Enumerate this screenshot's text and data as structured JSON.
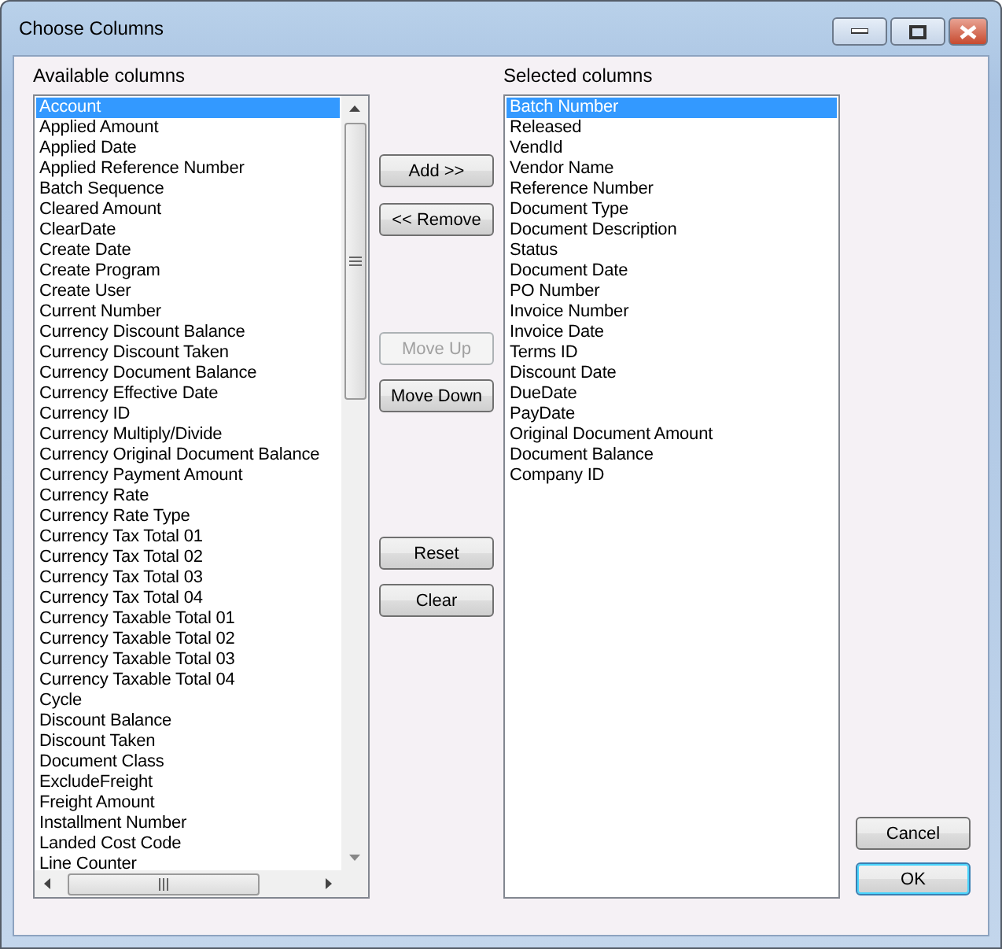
{
  "window": {
    "title": "Choose Columns"
  },
  "available": {
    "label": "Available columns",
    "items": [
      {
        "label": "Account",
        "selected": true
      },
      {
        "label": "Applied Amount",
        "selected": false
      },
      {
        "label": "Applied Date",
        "selected": false
      },
      {
        "label": "Applied Reference Number",
        "selected": false
      },
      {
        "label": "Batch Sequence",
        "selected": false
      },
      {
        "label": "Cleared Amount",
        "selected": false
      },
      {
        "label": "ClearDate",
        "selected": false
      },
      {
        "label": "Create Date",
        "selected": false
      },
      {
        "label": "Create Program",
        "selected": false
      },
      {
        "label": "Create User",
        "selected": false
      },
      {
        "label": "Current Number",
        "selected": false
      },
      {
        "label": "Currency Discount Balance",
        "selected": false
      },
      {
        "label": "Currency Discount Taken",
        "selected": false
      },
      {
        "label": "Currency Document Balance",
        "selected": false
      },
      {
        "label": "Currency Effective Date",
        "selected": false
      },
      {
        "label": "Currency ID",
        "selected": false
      },
      {
        "label": "Currency Multiply/Divide",
        "selected": false
      },
      {
        "label": "Currency Original Document Balance",
        "selected": false
      },
      {
        "label": "Currency Payment Amount",
        "selected": false
      },
      {
        "label": "Currency Rate",
        "selected": false
      },
      {
        "label": "Currency Rate Type",
        "selected": false
      },
      {
        "label": "Currency Tax Total 01",
        "selected": false
      },
      {
        "label": "Currency Tax Total 02",
        "selected": false
      },
      {
        "label": "Currency Tax Total 03",
        "selected": false
      },
      {
        "label": "Currency Tax Total 04",
        "selected": false
      },
      {
        "label": "Currency Taxable Total 01",
        "selected": false
      },
      {
        "label": "Currency Taxable Total 02",
        "selected": false
      },
      {
        "label": "Currency Taxable Total 03",
        "selected": false
      },
      {
        "label": "Currency Taxable Total 04",
        "selected": false
      },
      {
        "label": "Cycle",
        "selected": false
      },
      {
        "label": "Discount Balance",
        "selected": false
      },
      {
        "label": "Discount Taken",
        "selected": false
      },
      {
        "label": "Document Class",
        "selected": false
      },
      {
        "label": "ExcludeFreight",
        "selected": false
      },
      {
        "label": "Freight Amount",
        "selected": false
      },
      {
        "label": "Installment Number",
        "selected": false
      },
      {
        "label": "Landed Cost Code",
        "selected": false
      },
      {
        "label": "Line Counter",
        "selected": false
      }
    ]
  },
  "middle_buttons": [
    {
      "label": "Add >>",
      "disabled": false
    },
    {
      "label": "<< Remove",
      "disabled": false
    },
    {
      "label": "Move Up",
      "disabled": true
    },
    {
      "label": "Move Down",
      "disabled": false
    },
    {
      "label": "Reset",
      "disabled": false
    },
    {
      "label": "Clear",
      "disabled": false
    }
  ],
  "selected": {
    "label": "Selected columns",
    "items": [
      {
        "label": "Batch Number",
        "selected": true
      },
      {
        "label": "Released",
        "selected": false
      },
      {
        "label": "VendId",
        "selected": false
      },
      {
        "label": "Vendor Name",
        "selected": false
      },
      {
        "label": "Reference Number",
        "selected": false
      },
      {
        "label": "Document Type",
        "selected": false
      },
      {
        "label": "Document Description",
        "selected": false
      },
      {
        "label": "Status",
        "selected": false
      },
      {
        "label": "Document Date",
        "selected": false
      },
      {
        "label": "PO Number",
        "selected": false
      },
      {
        "label": "Invoice Number",
        "selected": false
      },
      {
        "label": "Invoice Date",
        "selected": false
      },
      {
        "label": "Terms ID",
        "selected": false
      },
      {
        "label": "Discount Date",
        "selected": false
      },
      {
        "label": "DueDate",
        "selected": false
      },
      {
        "label": "PayDate",
        "selected": false
      },
      {
        "label": "Original Document Amount",
        "selected": false
      },
      {
        "label": "Document Balance",
        "selected": false
      },
      {
        "label": "Company ID",
        "selected": false
      }
    ]
  },
  "dialog_buttons": [
    {
      "label": "Cancel",
      "default": false
    },
    {
      "label": "OK",
      "default": true
    }
  ]
}
